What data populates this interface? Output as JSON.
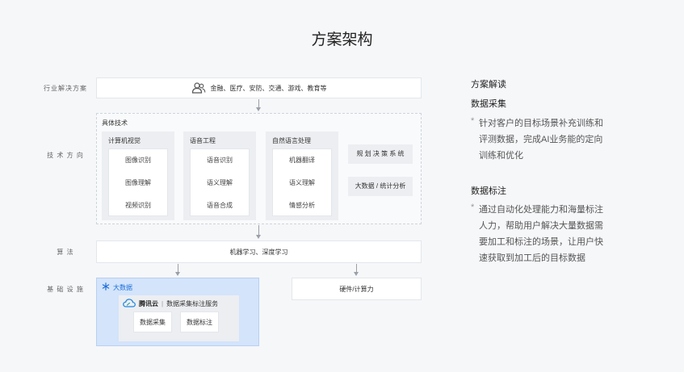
{
  "title": "方案架构",
  "row_labels": {
    "industry": "行业解决方案",
    "tech": "技 术 方 向",
    "algorithm": "算 法",
    "infrastructure": "基 础 设 施"
  },
  "industry_box": {
    "icon": "people-icon",
    "text": "金融、医疗、安防、交通、游戏、教育等"
  },
  "tech": {
    "title": "具体技术",
    "groups": [
      {
        "title": "计算机视觉",
        "items": [
          "图像识别",
          "图像理解",
          "视频识别"
        ]
      },
      {
        "title": "语音工程",
        "items": [
          "语音识别",
          "语义理解",
          "语音合成"
        ]
      },
      {
        "title": "自然语言处理",
        "items": [
          "机器翻译",
          "语义理解",
          "情感分析"
        ]
      }
    ],
    "side_items": [
      "规 划 决 策 系 统",
      "大数据 / 统计分析"
    ]
  },
  "algorithm": "机器学习、深度学习",
  "infrastructure": {
    "bigdata_label": "大数据",
    "brand": "腾讯云",
    "service": "数据采集标注服务",
    "items": [
      "数据采集",
      "数据标注"
    ],
    "hardware": "硬件/计算力"
  },
  "right_panel": {
    "heading": "方案解读",
    "sections": [
      {
        "title": "数据采集",
        "bullet": "*",
        "lines": [
          "针对客户的目标场景补充训练和",
          "评测数据，完成AI业务能的定向",
          "训练和优化"
        ]
      },
      {
        "title": "数据标注",
        "bullet": "*",
        "lines": [
          "通过自动化处理能力和海量标注",
          "人力，帮助用户解决大量数据需",
          "要加工和标注的场景，让用户快",
          "速获取到加工后的目标数据"
        ]
      }
    ]
  },
  "colors": {
    "background": "#f6f7f9",
    "bigdata_fill": "#d3e4fb",
    "accent_blue": "#1e6fd9",
    "panel_gray": "#eceef1"
  }
}
